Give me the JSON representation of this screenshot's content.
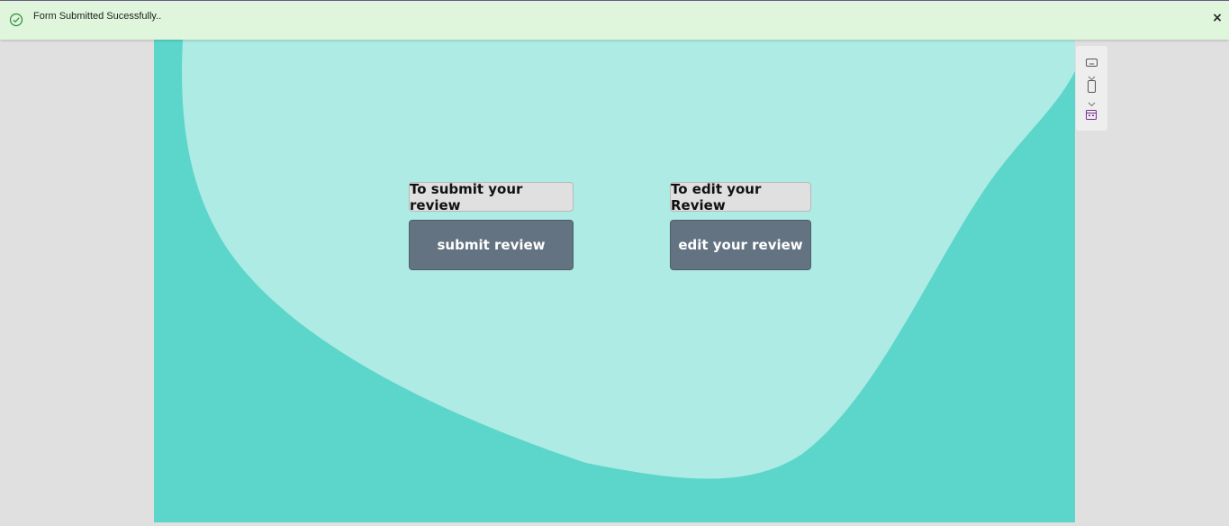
{
  "notification": {
    "message": "Form Submitted Sucessfully..",
    "close_symbol": "×",
    "status_color": "#2e8b3a"
  },
  "canvas": {
    "background_color": "#5cd6ca",
    "blob_color": "#adebe4",
    "submit_group": {
      "label": "To submit your review",
      "button": "submit review"
    },
    "edit_group": {
      "label": "To edit your Review",
      "button": "edit your review"
    }
  },
  "side_toolbar": {
    "icons": [
      "screen-icon",
      "chevron-down-icon",
      "phone-icon",
      "chevron-down-icon",
      "calendar-icon"
    ]
  }
}
